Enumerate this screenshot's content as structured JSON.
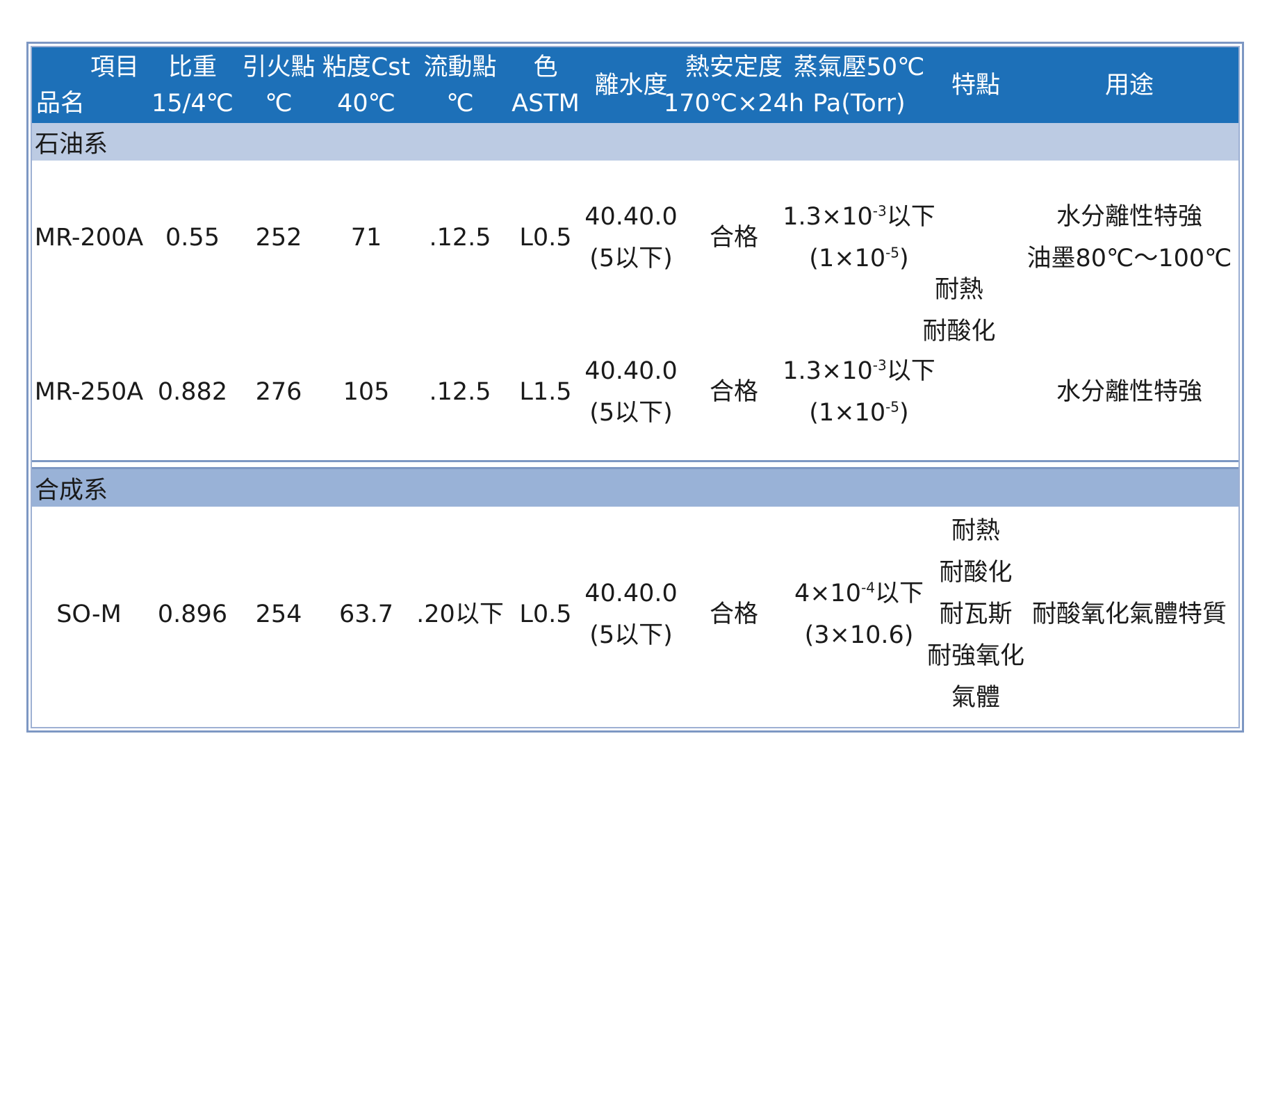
{
  "columns": {
    "name": {
      "line1": "項目",
      "line2": "品名"
    },
    "gravity": {
      "line1": "比重",
      "line2": "15/4℃"
    },
    "flash": {
      "line1": "引火點",
      "line2": "℃"
    },
    "viscosity": {
      "line1": "粘度Cst",
      "line2": "40℃"
    },
    "pour": {
      "line1": "流動點",
      "line2": "℃"
    },
    "color": {
      "line1": "色",
      "line2": "ASTM"
    },
    "demuls": {
      "line1": "離水度",
      "line2": ""
    },
    "thermal": {
      "line1": "熱安定度",
      "line2": "170℃×24h"
    },
    "vapor": {
      "line1": "蒸氣壓50℃",
      "line2": "Pa(Torr)"
    },
    "feature": {
      "line1": "特點",
      "line2": ""
    },
    "usage": {
      "line1": "用途",
      "line2": ""
    }
  },
  "groups": [
    {
      "title": "石油系",
      "feature_lines": [
        "耐熱",
        "耐酸化"
      ],
      "rows": [
        {
          "name": "MR-200A",
          "gravity": "0.55",
          "flash": "252",
          "viscosity": "71",
          "pour": ".12.5",
          "color": "L0.5",
          "demuls_1": "40.40.0",
          "demuls_2": "(5以下)",
          "thermal": "合格",
          "vapor_1_base": "1.3×10",
          "vapor_1_exp": "-3",
          "vapor_1_tail": "以下",
          "vapor_2_base": "(1×10",
          "vapor_2_exp": "-5",
          "vapor_2_tail": ")",
          "usage_lines": [
            "水分離性特強",
            "油墨80℃～100℃"
          ]
        },
        {
          "name": "MR-250A",
          "gravity": "0.882",
          "flash": "276",
          "viscosity": "105",
          "pour": ".12.5",
          "color": "L1.5",
          "demuls_1": "40.40.0",
          "demuls_2": "(5以下)",
          "thermal": "合格",
          "vapor_1_base": "1.3×10",
          "vapor_1_exp": "-3",
          "vapor_1_tail": "以下",
          "vapor_2_base": "(1×10",
          "vapor_2_exp": "-5",
          "vapor_2_tail": ")",
          "usage_lines": [
            "水分離性特強"
          ]
        }
      ]
    },
    {
      "title": "合成系",
      "feature_lines": [
        "耐熱",
        "耐酸化",
        "耐瓦斯",
        "耐強氧化",
        "氣體"
      ],
      "rows": [
        {
          "name": "SO-M",
          "gravity": "0.896",
          "flash": "254",
          "viscosity": "63.7",
          "pour": ".20以下",
          "color": "L0.5",
          "demuls_1": "40.40.0",
          "demuls_2": "(5以下)",
          "thermal": "合格",
          "vapor_1_base": "4×10",
          "vapor_1_exp": "-4",
          "vapor_1_tail": "以下",
          "vapor_2_base": "(3×10.6)",
          "vapor_2_exp": "",
          "vapor_2_tail": "",
          "usage_lines": [
            "耐酸氧化氣體特質"
          ]
        }
      ]
    }
  ]
}
